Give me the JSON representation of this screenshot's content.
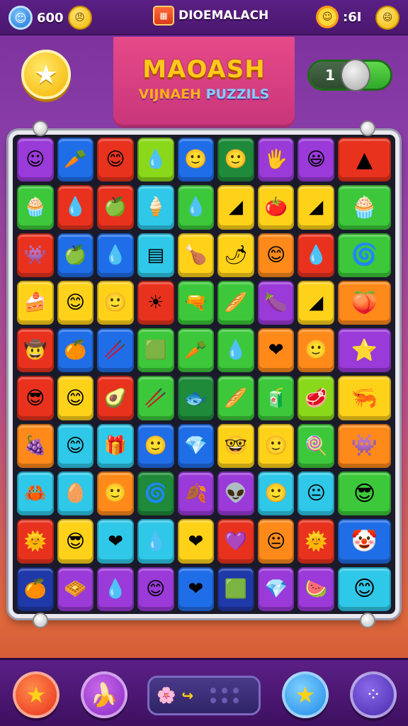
{
  "topbar": {
    "score": "600",
    "brand": "DIOEMALACH",
    "timer": ":6I",
    "icons": {
      "avatar": "avatar-face-icon",
      "coin_left": "emoji-coin-icon",
      "brand_box": "crate-icon",
      "sun": "sun-face-icon",
      "coin_right": "smiley-coin-icon"
    }
  },
  "title": {
    "main": "MAOASH",
    "sub_a": "VIJNAEH ",
    "sub_b": "PUZZILS"
  },
  "controls": {
    "star_icon": "star-icon",
    "toggle_value": "1"
  },
  "colors": {
    "red": "#e8321e",
    "blue": "#1f6ee8",
    "green": "#3cc83a",
    "yellow": "#ffd21a",
    "orange": "#ff8a1a",
    "purple": "#9a3ad8",
    "cyan": "#2fc8e8",
    "lime": "#8ad81a",
    "darkgreen": "#1f8a3a",
    "navy": "#1f3aa8"
  },
  "board": {
    "rows": [
      [
        [
          "purple",
          "☺"
        ],
        [
          "blue",
          "🥕"
        ],
        [
          "red",
          "😊"
        ],
        [
          "lime",
          "💧"
        ],
        [
          "blue",
          "🙂"
        ],
        [
          "darkgreen",
          "🙂"
        ],
        [
          "purple",
          "🖐"
        ],
        [
          "purple",
          "😃"
        ],
        [
          "red",
          "▲"
        ],
        [
          "red",
          ""
        ]
      ],
      [
        [
          "green",
          "🧁"
        ],
        [
          "red",
          "💧"
        ],
        [
          "red",
          "🍏"
        ],
        [
          "cyan",
          "🍦"
        ],
        [
          "green",
          "💧"
        ],
        [
          "yellow",
          "◢"
        ],
        [
          "yellow",
          "🍅"
        ],
        [
          "yellow",
          "◢"
        ],
        [
          "green",
          "🧁"
        ],
        [
          "green",
          ""
        ]
      ],
      [
        [
          "red",
          "👾"
        ],
        [
          "blue",
          "🍏"
        ],
        [
          "blue",
          "💧"
        ],
        [
          "cyan",
          "▤"
        ],
        [
          "yellow",
          "🍗"
        ],
        [
          "yellow",
          "🌶"
        ],
        [
          "orange",
          "😊"
        ],
        [
          "red",
          "💧"
        ],
        [
          "green",
          "🌀"
        ],
        [
          "green",
          ""
        ]
      ],
      [
        [
          "yellow",
          "🍰"
        ],
        [
          "yellow",
          "😊"
        ],
        [
          "yellow",
          "🙂"
        ],
        [
          "red",
          "☀"
        ],
        [
          "green",
          "🔫"
        ],
        [
          "green",
          "🥖"
        ],
        [
          "purple",
          "🍆"
        ],
        [
          "yellow",
          "◢"
        ],
        [
          "orange",
          "🍑"
        ],
        [
          "orange",
          ""
        ]
      ],
      [
        [
          "red",
          "🤠"
        ],
        [
          "blue",
          "🍊"
        ],
        [
          "blue",
          "🥢"
        ],
        [
          "green",
          "🟩"
        ],
        [
          "green",
          "🥕"
        ],
        [
          "green",
          "💧"
        ],
        [
          "orange",
          "❤"
        ],
        [
          "orange",
          "🙂"
        ],
        [
          "purple",
          "⭐"
        ],
        [
          "purple",
          ""
        ]
      ],
      [
        [
          "red",
          "😎"
        ],
        [
          "yellow",
          "😊"
        ],
        [
          "red",
          "🥑"
        ],
        [
          "green",
          "🥢"
        ],
        [
          "darkgreen",
          "🐟"
        ],
        [
          "green",
          "🥖"
        ],
        [
          "green",
          "🧃"
        ],
        [
          "lime",
          "🥩"
        ],
        [
          "yellow",
          "🦐"
        ],
        [
          "yellow",
          ""
        ]
      ],
      [
        [
          "orange",
          "🍇"
        ],
        [
          "cyan",
          "😊"
        ],
        [
          "cyan",
          "🎁"
        ],
        [
          "blue",
          "🙂"
        ],
        [
          "blue",
          "💎"
        ],
        [
          "yellow",
          "🤓"
        ],
        [
          "yellow",
          "🙂"
        ],
        [
          "green",
          "🍭"
        ],
        [
          "orange",
          "👾"
        ],
        [
          "orange",
          ""
        ]
      ],
      [
        [
          "cyan",
          "🦀"
        ],
        [
          "cyan",
          "🥚"
        ],
        [
          "orange",
          "🙂"
        ],
        [
          "darkgreen",
          "🌀"
        ],
        [
          "purple",
          "🍂"
        ],
        [
          "purple",
          "👽"
        ],
        [
          "cyan",
          "🙂"
        ],
        [
          "cyan",
          "😐"
        ],
        [
          "green",
          "😎"
        ],
        [
          "green",
          ""
        ]
      ],
      [
        [
          "red",
          "🌞"
        ],
        [
          "yellow",
          "😎"
        ],
        [
          "cyan",
          "❤"
        ],
        [
          "cyan",
          "💧"
        ],
        [
          "yellow",
          "❤"
        ],
        [
          "red",
          "💜"
        ],
        [
          "orange",
          "😐"
        ],
        [
          "red",
          "🌞"
        ],
        [
          "blue",
          "🤡"
        ],
        [
          "blue",
          ""
        ]
      ],
      [
        [
          "navy",
          "🍊"
        ],
        [
          "purple",
          "🧇"
        ],
        [
          "purple",
          "💧"
        ],
        [
          "purple",
          "😊"
        ],
        [
          "blue",
          "❤"
        ],
        [
          "navy",
          "🟩"
        ],
        [
          "purple",
          "💎"
        ],
        [
          "purple",
          "🍉"
        ],
        [
          "cyan",
          "😊"
        ],
        [
          "cyan",
          ""
        ]
      ]
    ]
  },
  "bottombar": {
    "buttons": [
      "star-icon",
      "banana-icon",
      "smiley-icon",
      "menu-dots-icon"
    ],
    "slot_icon": "flower-icon",
    "slot_arrow": "↪"
  }
}
